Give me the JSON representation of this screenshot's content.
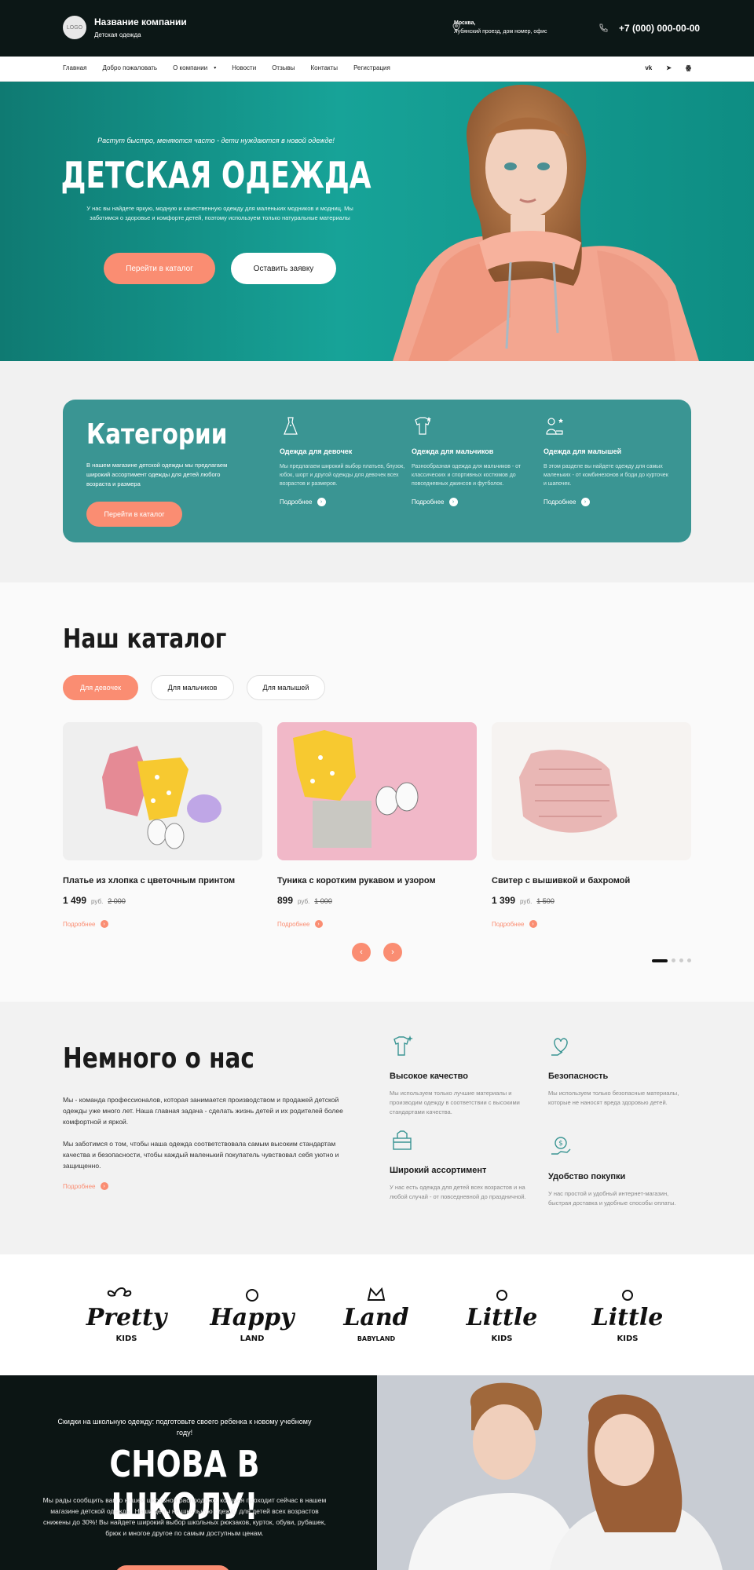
{
  "header": {
    "logo_text": "LOGO",
    "company_name": "Название компании",
    "company_sub": "Детская одежда",
    "city": "Москва,",
    "address": "Лубянский проезд, дом номер, офис",
    "phone": "+7 (000) 000-00-00"
  },
  "nav": {
    "items": [
      "Главная",
      "Добро пожаловать",
      "О компании",
      "Новости",
      "Отзывы",
      "Контакты",
      "Регистрация"
    ],
    "social": [
      "vk-icon",
      "telegram-icon",
      "odnoklassniki-icon"
    ]
  },
  "hero": {
    "tagline": "Растут быстро, меняются часто - дети нуждаются в новой одежде!",
    "title": "ДЕТСКАЯ ОДЕЖДА",
    "description": "У нас вы найдете яркую, модную и качественную одежду для маленьких модников и модниц. Мы заботимся о здоровье и комфорте детей, поэтому используем только натуральные материалы",
    "btn_catalog": "Перейти в каталог",
    "btn_request": "Оставить заявку"
  },
  "categories": {
    "title": "Категории",
    "description": "В нашем магазине детской одежды мы предлагаем широкий ассортимент одежды для детей любого возраста и размера",
    "button": "Перейти в каталог",
    "more": "Подробнее",
    "items": [
      {
        "icon": "dress-icon",
        "title": "Одежда для девочек",
        "desc": "Мы предлагаем широкий выбор платьев, блузок, юбок, шорт и другой одежды для девочек всех возрастов и размеров."
      },
      {
        "icon": "boy-clothes-icon",
        "title": "Одежда для мальчиков",
        "desc": "Разнообразная одежда для мальчиков - от классических и спортивных костюмов до повседневных джинсов и футболок."
      },
      {
        "icon": "baby-icon",
        "title": "Одежда для малышей",
        "desc": "В этом разделе вы найдете одежду для самых маленьких - от комбинезонов и боди до курточек и шапочек."
      }
    ]
  },
  "catalog": {
    "title": "Наш каталог",
    "tabs": [
      "Для девочек",
      "Для мальчиков",
      "Для малышей"
    ],
    "currency": "руб.",
    "more": "Подробнее",
    "products": [
      {
        "name": "Платье из хлопка с цветочным принтом",
        "price": "1 499",
        "old_price": "2 000"
      },
      {
        "name": "Туника с коротким рукавом и узором",
        "price": "899",
        "old_price": "1 000"
      },
      {
        "name": "Свитер с вышивкой и бахромой",
        "price": "1 399",
        "old_price": "1 500"
      }
    ],
    "prev": "‹",
    "next": "›"
  },
  "about": {
    "title": "Немного о нас",
    "p1": "Мы - команда профессионалов, которая занимается производством и продажей детской одежды уже много лет. Наша главная задача - сделать жизнь детей и их родителей более комфортной и яркой.",
    "p2": "Мы заботимся о том, чтобы наша одежда соответствовала самым высоким стандартам качества и безопасности, чтобы каждый маленький покупатель чувствовал себя уютно и защищенно.",
    "more": "Подробнее",
    "features": [
      {
        "icon": "shirt-sparkle-icon",
        "title": "Высокое качество",
        "desc": "Мы используем только лучшие материалы и производим одежду в соответствии с высокими стандартами качества."
      },
      {
        "icon": "heart-hand-icon",
        "title": "Безопасность",
        "desc": "Мы используем только безопасные материалы, которые не наносят вреда здоровью детей."
      },
      {
        "icon": "box-clothes-icon",
        "title": "Широкий ассортимент",
        "desc": "У нас есть одежда для детей всех возрастов и на любой случай - от повседневной до праздничной."
      },
      {
        "icon": "money-hand-icon",
        "title": "Удобство покупки",
        "desc": "У нас простой и удобный интернет-магазин, быстрая доставка и удобные способы оплаты."
      }
    ]
  },
  "brands": [
    {
      "main": "Pretty",
      "sub": "KIDS"
    },
    {
      "main": "Happy",
      "sub": "LAND"
    },
    {
      "main": "Land",
      "sub": "BABYLAND"
    },
    {
      "main": "Little",
      "sub": "KIDS"
    },
    {
      "main": "Little",
      "sub": "KIDS"
    }
  ],
  "school": {
    "tagline": "Скидки на школьную одежду: подготовьте своего ребенка к новому учебному году!",
    "title": "СНОВА В ШКОЛУ!",
    "description": "Мы рады сообщить вам о нашей школьной распродаже, которая проходит сейчас в нашем магазине детской одежды. Наши цены на школьную одежду для детей всех возрастов снижены до 30%! Вы найдете широкий выбор школьных рюкзаков, курток, обуви, рубашек, брюк и многое другое по самым доступным ценам."
  },
  "colors": {
    "accent": "#fa8d72",
    "teal": "#3a9593",
    "dark": "#0c1716"
  }
}
